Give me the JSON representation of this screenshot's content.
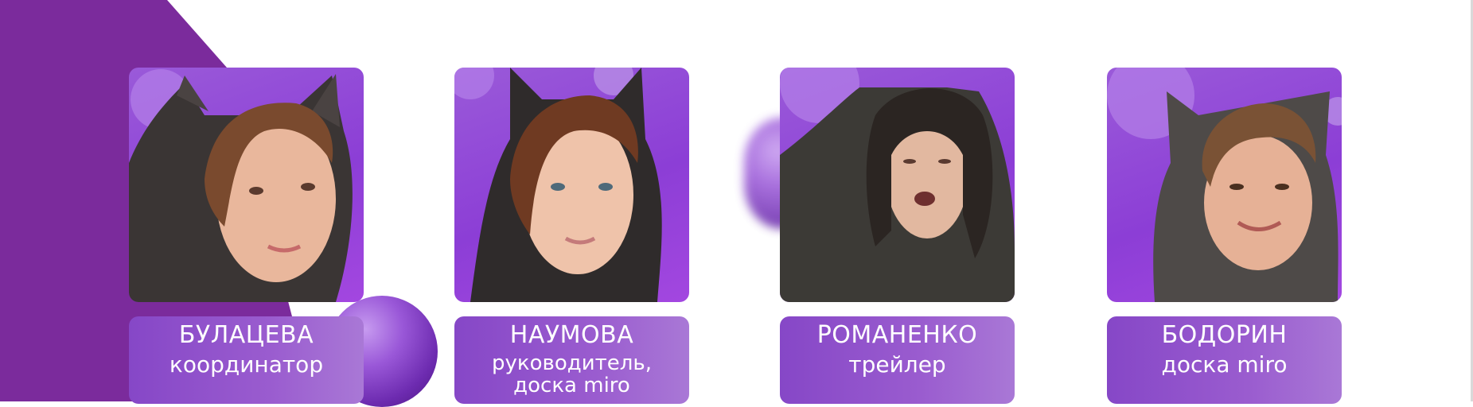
{
  "members": [
    {
      "name": "БУЛАЦЕВА",
      "role": "координатор"
    },
    {
      "name": "НАУМОВА",
      "role": "руководитель, доска miro"
    },
    {
      "name": "РОМАНЕНКО",
      "role": "трейлер"
    },
    {
      "name": "БОДОРИН",
      "role": "доска miro"
    }
  ],
  "colors": {
    "accent": "#7a2a9e",
    "card": "#8f52cc",
    "photo_bg": "#9a4fd9",
    "text": "#ffffff"
  }
}
